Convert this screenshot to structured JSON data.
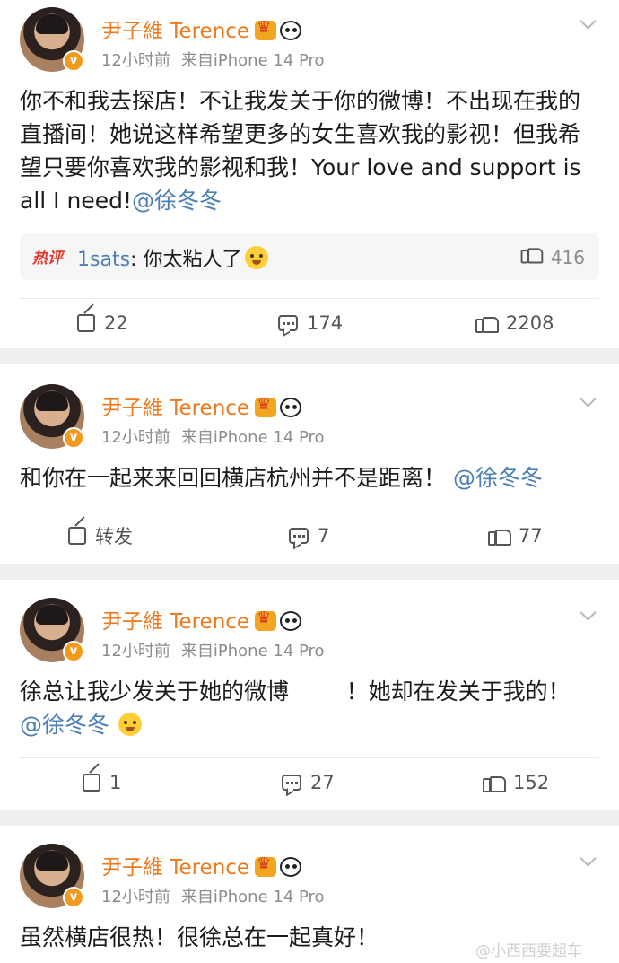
{
  "posts": [
    {
      "author": "尹子維 Terence",
      "time": "12小时前",
      "source": "来自iPhone 14 Pro",
      "text_main": "你不和我去探店！不让我发关于你的微博！不出现在我的直播间！她说这样希望更多的女生喜欢我的影视！但我希望只要你喜欢我的影视和我！Your love and support is all I need!",
      "mention": "@徐冬冬",
      "hot_comment": {
        "tag": "热评",
        "user": "1sats",
        "text": "你太粘人了",
        "likes": "416"
      },
      "repost": "22",
      "comments": "174",
      "likes": "2208"
    },
    {
      "author": "尹子維 Terence",
      "time": "12小时前",
      "source": "来自iPhone 14 Pro",
      "text_main": "和你在一起来来回回横店杭州并不是距离！",
      "mention": "@徐冬冬",
      "repost": "转发",
      "comments": "7",
      "likes": "77"
    },
    {
      "author": "尹子維 Terence",
      "time": "12小时前",
      "source": "来自iPhone 14 Pro",
      "text_main": "徐总让我少发关于她的微博        ！她却在发关于我的！",
      "mention": "@徐冬冬",
      "repost": "1",
      "comments": "27",
      "likes": "152"
    },
    {
      "author": "尹子維 Terence",
      "time": "12小时前",
      "source": "来自iPhone 14 Pro",
      "text_main": "虽然横店很热！很徐总在一起真好！"
    }
  ],
  "watermark": "@小西西要超车",
  "colors": {
    "name": "#ee7a1d",
    "mention": "#4d7fb7",
    "hot": "#e8362a"
  }
}
